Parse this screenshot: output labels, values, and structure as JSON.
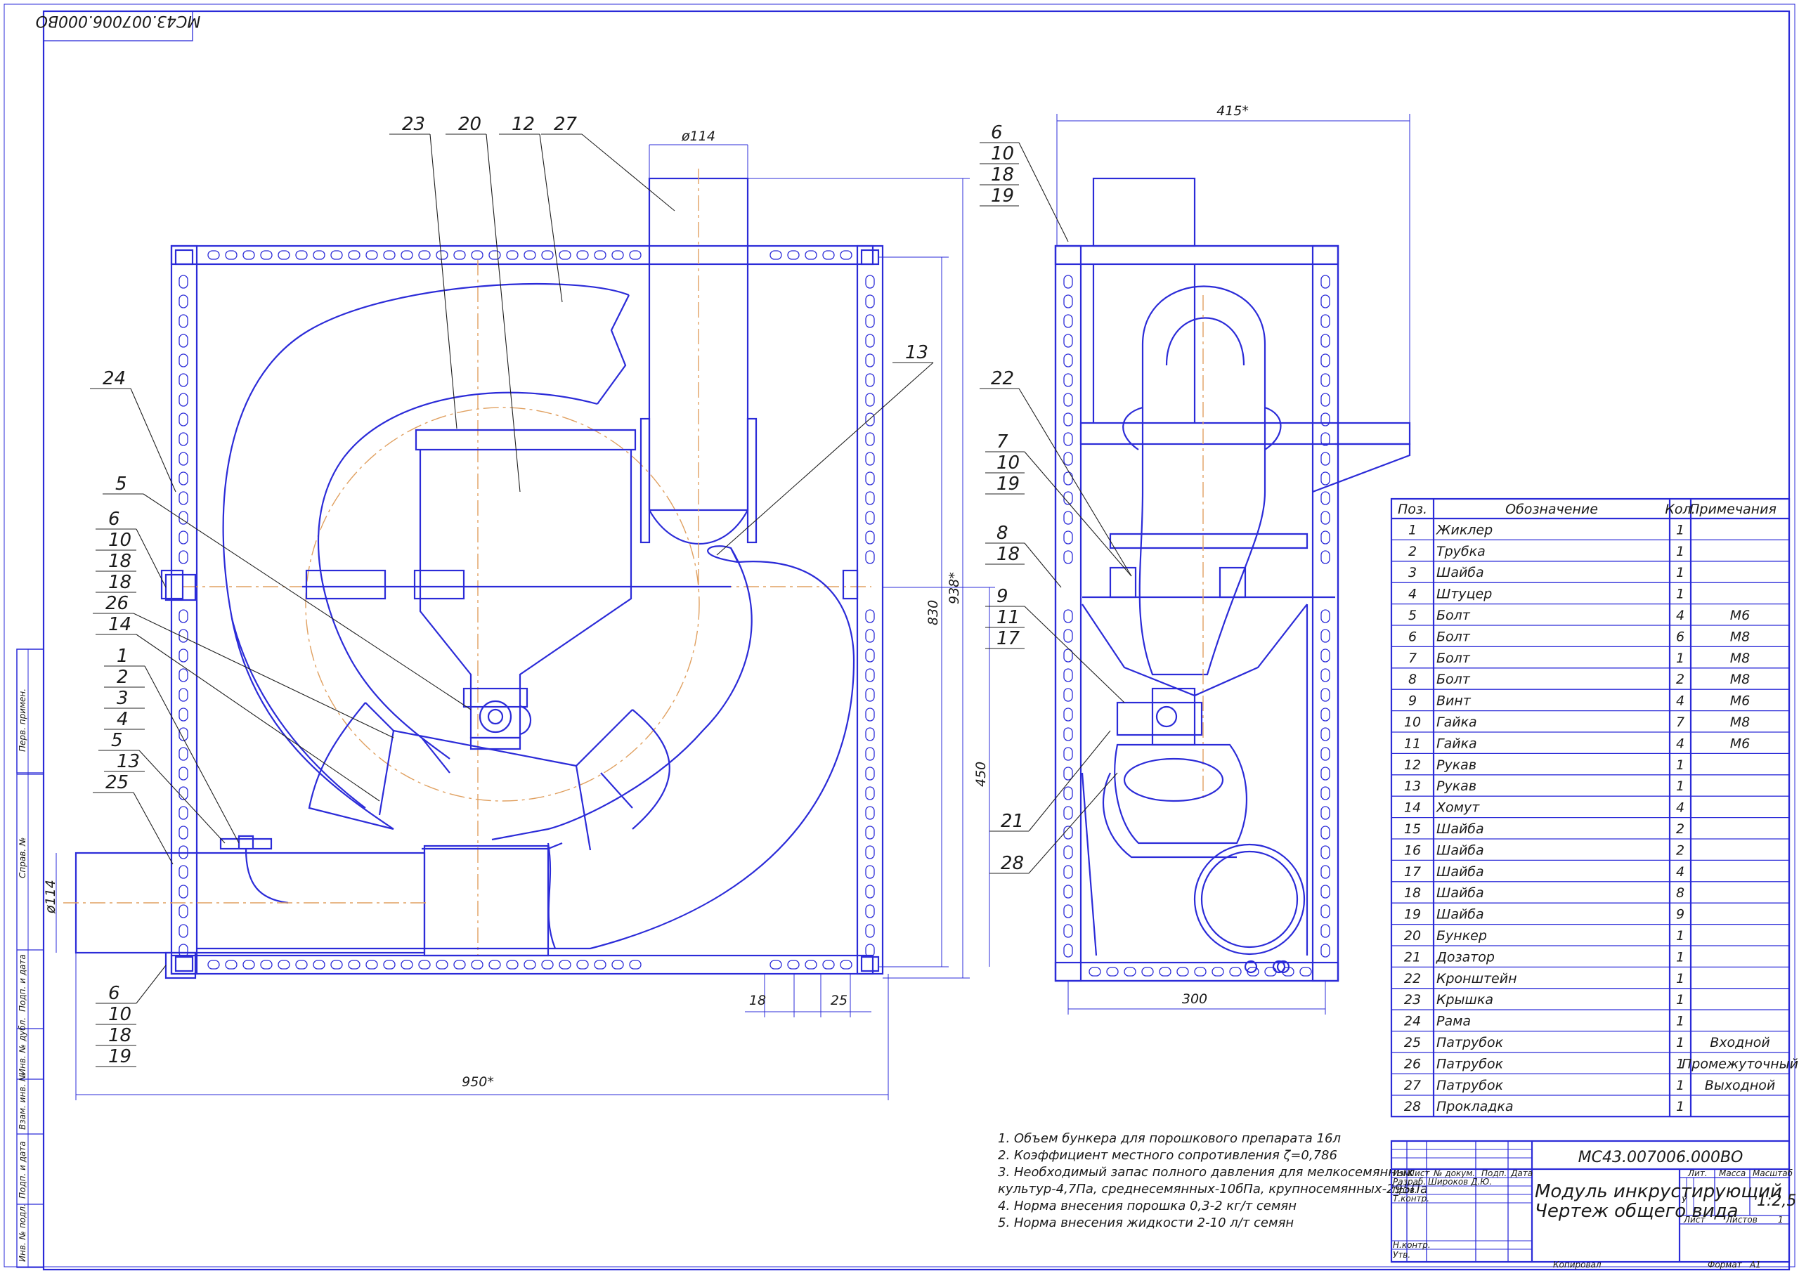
{
  "stamp_top": "МС43.007006.000ВО",
  "side_stamps": [
    "Перв. примен.",
    "Справ. №",
    "Подп. и дата",
    "Инв. № дубл.",
    "Взам. инв. №",
    "Подп. и дата",
    "Инв. № подл."
  ],
  "front_view": {
    "leaders": [
      "23",
      "20",
      "12",
      "27",
      "13",
      "24",
      "5",
      "6",
      "10",
      "18",
      "18",
      "26",
      "14",
      "1",
      "2",
      "3",
      "4",
      "5",
      "13",
      "25",
      "6",
      "10",
      "18",
      "19"
    ],
    "dims": {
      "d_top": "ø114",
      "d_left": "ø114",
      "h_830": "830",
      "h_938": "938*",
      "h_450": "450",
      "w_950": "950*",
      "d18": "18",
      "d25": "25"
    }
  },
  "side_view": {
    "leaders": [
      "6",
      "10",
      "18",
      "19",
      "22",
      "7",
      "10",
      "19",
      "8",
      "18",
      "9",
      "11",
      "17",
      "21",
      "28"
    ],
    "dims": {
      "w_415": "415*",
      "w_300": "300"
    }
  },
  "spec_table": {
    "headers": [
      "Поз.",
      "Обозначение",
      "Кол.",
      "Примечания"
    ],
    "rows": [
      [
        "1",
        "Жиклер",
        "1",
        ""
      ],
      [
        "2",
        "Трубка",
        "1",
        ""
      ],
      [
        "3",
        "Шайба",
        "1",
        ""
      ],
      [
        "4",
        "Штуцер",
        "1",
        ""
      ],
      [
        "5",
        "Болт",
        "4",
        "М6"
      ],
      [
        "6",
        "Болт",
        "6",
        "М8"
      ],
      [
        "7",
        "Болт",
        "1",
        "М8"
      ],
      [
        "8",
        "Болт",
        "2",
        "М8"
      ],
      [
        "9",
        "Винт",
        "4",
        "М6"
      ],
      [
        "10",
        "Гайка",
        "7",
        "М8"
      ],
      [
        "11",
        "Гайка",
        "4",
        "М6"
      ],
      [
        "12",
        "Рукав",
        "1",
        ""
      ],
      [
        "13",
        "Рукав",
        "1",
        ""
      ],
      [
        "14",
        "Хомут",
        "4",
        ""
      ],
      [
        "15",
        "Шайба",
        "2",
        ""
      ],
      [
        "16",
        "Шайба",
        "2",
        ""
      ],
      [
        "17",
        "Шайба",
        "4",
        ""
      ],
      [
        "18",
        "Шайба",
        "8",
        ""
      ],
      [
        "19",
        "Шайба",
        "9",
        ""
      ],
      [
        "20",
        "Бункер",
        "1",
        ""
      ],
      [
        "21",
        "Дозатор",
        "1",
        ""
      ],
      [
        "22",
        "Кронштейн",
        "1",
        ""
      ],
      [
        "23",
        "Крышка",
        "1",
        ""
      ],
      [
        "24",
        "Рама",
        "1",
        ""
      ],
      [
        "25",
        "Патрубок",
        "1",
        "Входной"
      ],
      [
        "26",
        "Патрубок",
        "1",
        "Промежуточный"
      ],
      [
        "27",
        "Патрубок",
        "1",
        "Выходной"
      ],
      [
        "28",
        "Прокладка",
        "1",
        ""
      ]
    ]
  },
  "notes": [
    "1. Объем бункера для порошкового препарата 16л",
    "2. Коэффициент местного сопротивления ζ=0,786",
    "3. Необходимый запас полного давления для мелкосемянных",
    "культур-4,7Па, среднесемянных-10бПа, крупносемянных-295Па",
    "4. Норма внесения порошка 0,3-2 кг/т семян",
    "5. Норма внесения жидкости 2-10 л/т семян"
  ],
  "title_block": {
    "code": "МС43.007006.000ВО",
    "title_line1": "Модуль инкрустирующий",
    "title_line2": "Чертеж общего вида",
    "col_labels": [
      "Изм.",
      "Лист",
      "№ докум.",
      "Подп.",
      "Дата"
    ],
    "roles": [
      "Разраб.",
      "Пров.",
      "Т.контр.",
      "Н.контр.",
      "Утв."
    ],
    "developer": "Широков Д.Ю.",
    "lit": "Лит.",
    "mass": "Масса",
    "scale_label": "Масштаб",
    "scale": "1:2,5",
    "sheet": "Лист",
    "sheets": "Листов",
    "sheets_count": "1",
    "lit_value": "У",
    "copied": "Копировал",
    "format": "Формат",
    "format_value": "А1"
  }
}
